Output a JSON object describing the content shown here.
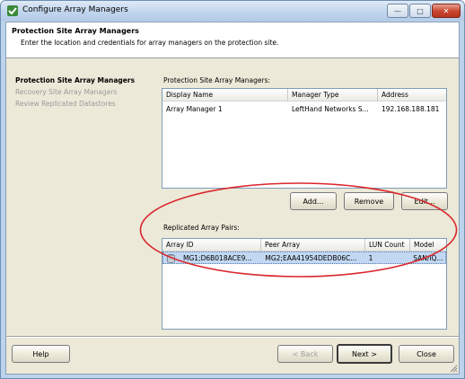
{
  "window": {
    "title": "Configure Array Managers",
    "min_glyph": "—",
    "max_glyph": "□",
    "close_glyph": "✕"
  },
  "header": {
    "title": "Protection Site Array Managers",
    "subtitle": "Enter the location and credentials for array managers on the protection site."
  },
  "nav": {
    "items": [
      {
        "label": "Protection Site Array Managers",
        "active": true
      },
      {
        "label": "Recovery Site Array Managers",
        "active": false
      },
      {
        "label": "Review Replicated Datastores",
        "active": false
      }
    ]
  },
  "managers": {
    "section_label": "Protection Site Array Managers:",
    "columns": [
      "Display Name",
      "Manager Type",
      "Address"
    ],
    "rows": [
      [
        "Array Manager 1",
        "LeftHand Networks S...",
        "192.168.188.181"
      ]
    ],
    "add_label": "Add...",
    "remove_label": "Remove",
    "edit_label": "Edit..."
  },
  "pairs": {
    "section_label": "Replicated Array Pairs:",
    "columns": [
      "Array ID",
      "Peer Array",
      "LUN Count",
      "Model"
    ],
    "rows": [
      [
        "MG1;D6B018ACE9...",
        "MG2;EAA41954DEDB06C...",
        "1",
        "SAN/iQ..."
      ]
    ]
  },
  "footer": {
    "help_label": "Help",
    "back_label": "< Back",
    "next_label": "Next >",
    "close_label": "Close"
  },
  "annotation": {
    "ellipse_color": "#d9262b"
  }
}
